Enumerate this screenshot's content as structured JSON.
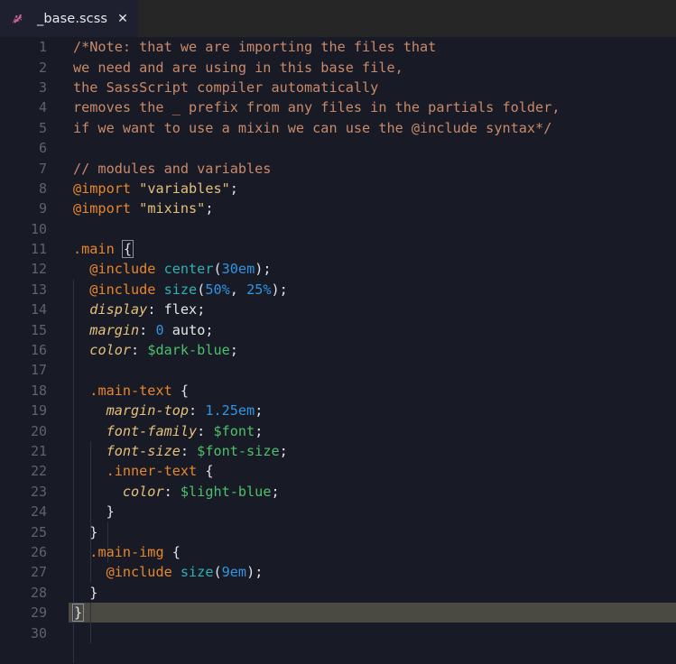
{
  "window": {
    "app": "code-editor",
    "colors": {
      "tabbar_bg": "#262626",
      "tab_active_bg": "#1e2030",
      "editor_bg": "#181a26",
      "active_line": "#4b4a42",
      "linenumber": "#5c6370",
      "comment": "#c98a6a",
      "keyword": "#e8862b",
      "string": "#e5c07b",
      "mixin": "#2bb3b3",
      "number": "#2f95e0",
      "property": "#e5c07b",
      "variable": "#4cc16a",
      "sass_logo": "#cd6799"
    }
  },
  "tab": {
    "icon": "sass-logo-icon",
    "filename": "_base.scss",
    "close_label": "✕"
  },
  "editor": {
    "language": "scss",
    "active_line": 29,
    "total_lines_visible": 30,
    "line_numbers": [
      "1",
      "2",
      "3",
      "4",
      "5",
      "6",
      "7",
      "8",
      "9",
      "10",
      "11",
      "12",
      "13",
      "14",
      "15",
      "16",
      "17",
      "18",
      "19",
      "20",
      "21",
      "22",
      "23",
      "24",
      "25",
      "26",
      "27",
      "28",
      "29",
      "30"
    ],
    "lines": [
      {
        "n": "1",
        "text": "/*Note: that we are importing the files that"
      },
      {
        "n": "2",
        "text": "we need and are using in this base file,"
      },
      {
        "n": "3",
        "text": "the SassScript compiler automatically"
      },
      {
        "n": "4",
        "text": "removes the _ prefix from any files in the partials folder,"
      },
      {
        "n": "5",
        "text": "if we want to use a mixin we can use the @include syntax*/"
      },
      {
        "n": "6",
        "text": ""
      },
      {
        "n": "7",
        "text": "// modules and variables"
      },
      {
        "n": "8",
        "text": "@import \"variables\";"
      },
      {
        "n": "9",
        "text": "@import \"mixins\";"
      },
      {
        "n": "10",
        "text": ""
      },
      {
        "n": "11",
        "text": ".main {"
      },
      {
        "n": "12",
        "text": "  @include center(30em);"
      },
      {
        "n": "13",
        "text": "  @include size(50%, 25%);"
      },
      {
        "n": "14",
        "text": "  display: flex;"
      },
      {
        "n": "15",
        "text": "  margin: 0 auto;"
      },
      {
        "n": "16",
        "text": "  color: $dark-blue;"
      },
      {
        "n": "17",
        "text": ""
      },
      {
        "n": "18",
        "text": "  .main-text {"
      },
      {
        "n": "19",
        "text": "    margin-top: 1.25em;"
      },
      {
        "n": "20",
        "text": "    font-family: $font;"
      },
      {
        "n": "21",
        "text": "    font-size: $font-size;"
      },
      {
        "n": "22",
        "text": "    .inner-text {"
      },
      {
        "n": "23",
        "text": "      color: $light-blue;"
      },
      {
        "n": "24",
        "text": "    }"
      },
      {
        "n": "25",
        "text": "  }"
      },
      {
        "n": "26",
        "text": "  .main-img {"
      },
      {
        "n": "27",
        "text": "    @include size(9em);"
      },
      {
        "n": "28",
        "text": "  }"
      },
      {
        "n": "29",
        "text": "}"
      },
      {
        "n": "30",
        "text": ""
      }
    ],
    "tokens": {
      "comment_open": "/*Note:",
      "comment_close": "syntax*/",
      "line_comment": "// modules and variables",
      "import_keyword": "@import",
      "include_keyword": "@include",
      "string_variables": "\"variables\"",
      "string_mixins": "\"mixins\"",
      "selector_main": ".main",
      "selector_main_text": ".main-text",
      "selector_inner_text": ".inner-text",
      "selector_main_img": ".main-img",
      "mixin_center": "center",
      "mixin_size": "size",
      "property_display": "display",
      "property_margin": "margin",
      "property_color": "color",
      "property_margin_top": "margin-top",
      "property_font_family": "font-family",
      "property_font_size": "font-size",
      "value_flex": "flex",
      "value_auto": "auto",
      "var_dark_blue": "$dark-blue",
      "var_light_blue": "$light-blue",
      "var_font": "$font",
      "var_font_size": "$font-size",
      "num_30em": "30em",
      "num_50pct": "50%",
      "num_25pct": "25%",
      "num_0": "0",
      "num_125em": "1.25em",
      "num_9em": "9em",
      "open_brace": "{",
      "close_brace": "}"
    }
  }
}
